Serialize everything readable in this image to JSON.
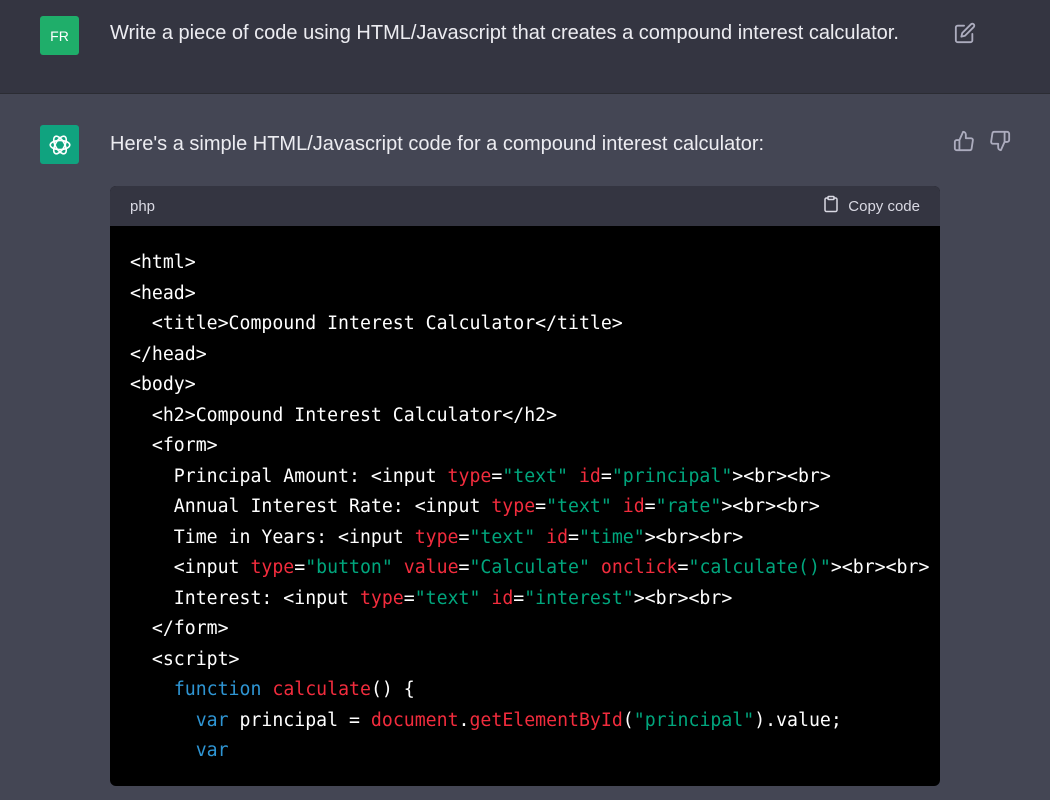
{
  "user_message": {
    "avatar_initials": "FR",
    "text": "Write a piece of code using HTML/Javascript that creates a compound interest calculator.",
    "edit_icon": "edit-icon"
  },
  "assistant_message": {
    "avatar_icon": "openai-logo-icon",
    "text": "Here's a simple HTML/Javascript code for a compound interest calculator:",
    "feedback_icons": [
      "thumbs-up-icon",
      "thumbs-down-icon"
    ]
  },
  "code_block": {
    "language": "php",
    "copy_label": "Copy code",
    "lines": [
      [
        {
          "t": "<html>",
          "c": "text"
        }
      ],
      [
        {
          "t": "<head>",
          "c": "text"
        }
      ],
      [
        {
          "t": "  <title>Compound Interest Calculator</title>",
          "c": "text"
        }
      ],
      [
        {
          "t": "</head>",
          "c": "text"
        }
      ],
      [
        {
          "t": "<body>",
          "c": "text"
        }
      ],
      [
        {
          "t": "  <h2>Compound Interest Calculator</h2>",
          "c": "text"
        }
      ],
      [
        {
          "t": "  <form>",
          "c": "text"
        }
      ],
      [
        {
          "t": "    Principal Amount: <input ",
          "c": "text"
        },
        {
          "t": "type",
          "c": "attr"
        },
        {
          "t": "=",
          "c": "text"
        },
        {
          "t": "\"text\"",
          "c": "str"
        },
        {
          "t": " ",
          "c": "text"
        },
        {
          "t": "id",
          "c": "attr"
        },
        {
          "t": "=",
          "c": "text"
        },
        {
          "t": "\"principal\"",
          "c": "str"
        },
        {
          "t": "><br><br>",
          "c": "text"
        }
      ],
      [
        {
          "t": "    Annual Interest Rate: <input ",
          "c": "text"
        },
        {
          "t": "type",
          "c": "attr"
        },
        {
          "t": "=",
          "c": "text"
        },
        {
          "t": "\"text\"",
          "c": "str"
        },
        {
          "t": " ",
          "c": "text"
        },
        {
          "t": "id",
          "c": "attr"
        },
        {
          "t": "=",
          "c": "text"
        },
        {
          "t": "\"rate\"",
          "c": "str"
        },
        {
          "t": "><br><br>",
          "c": "text"
        }
      ],
      [
        {
          "t": "    Time in Years: <input ",
          "c": "text"
        },
        {
          "t": "type",
          "c": "attr"
        },
        {
          "t": "=",
          "c": "text"
        },
        {
          "t": "\"text\"",
          "c": "str"
        },
        {
          "t": " ",
          "c": "text"
        },
        {
          "t": "id",
          "c": "attr"
        },
        {
          "t": "=",
          "c": "text"
        },
        {
          "t": "\"time\"",
          "c": "str"
        },
        {
          "t": "><br><br>",
          "c": "text"
        }
      ],
      [
        {
          "t": "    <input ",
          "c": "text"
        },
        {
          "t": "type",
          "c": "attr"
        },
        {
          "t": "=",
          "c": "text"
        },
        {
          "t": "\"button\"",
          "c": "str"
        },
        {
          "t": " ",
          "c": "text"
        },
        {
          "t": "value",
          "c": "attr"
        },
        {
          "t": "=",
          "c": "text"
        },
        {
          "t": "\"Calculate\"",
          "c": "str"
        },
        {
          "t": " ",
          "c": "text"
        },
        {
          "t": "onclick",
          "c": "attr"
        },
        {
          "t": "=",
          "c": "text"
        },
        {
          "t": "\"calculate()\"",
          "c": "str"
        },
        {
          "t": "><br><br>",
          "c": "text"
        }
      ],
      [
        {
          "t": "    Interest: <input ",
          "c": "text"
        },
        {
          "t": "type",
          "c": "attr"
        },
        {
          "t": "=",
          "c": "text"
        },
        {
          "t": "\"text\"",
          "c": "str"
        },
        {
          "t": " ",
          "c": "text"
        },
        {
          "t": "id",
          "c": "attr"
        },
        {
          "t": "=",
          "c": "text"
        },
        {
          "t": "\"interest\"",
          "c": "str"
        },
        {
          "t": "><br><br>",
          "c": "text"
        }
      ],
      [
        {
          "t": "  </form>",
          "c": "text"
        }
      ],
      [
        {
          "t": "  <script>",
          "c": "text"
        }
      ],
      [
        {
          "t": "    ",
          "c": "text"
        },
        {
          "t": "function",
          "c": "kw"
        },
        {
          "t": " ",
          "c": "text"
        },
        {
          "t": "calculate",
          "c": "fn"
        },
        {
          "t": "() {",
          "c": "text"
        }
      ],
      [
        {
          "t": "      ",
          "c": "text"
        },
        {
          "t": "var",
          "c": "kw"
        },
        {
          "t": " principal = ",
          "c": "text"
        },
        {
          "t": "document",
          "c": "fn"
        },
        {
          "t": ".",
          "c": "text"
        },
        {
          "t": "getElementById",
          "c": "fn"
        },
        {
          "t": "(",
          "c": "text"
        },
        {
          "t": "\"principal\"",
          "c": "str"
        },
        {
          "t": ").value;",
          "c": "text"
        }
      ],
      [
        {
          "t": "      ",
          "c": "text"
        },
        {
          "t": "var",
          "c": "kw"
        }
      ]
    ]
  },
  "colors": {
    "user_bg": "#343541",
    "assistant_bg": "#444654",
    "code_bg": "#000000",
    "code_header_bg": "#343541",
    "accent_green": "#10a37f",
    "attr_red": "#f22c3d",
    "string_green": "#00a67d",
    "keyword_blue": "#2e95d3"
  }
}
